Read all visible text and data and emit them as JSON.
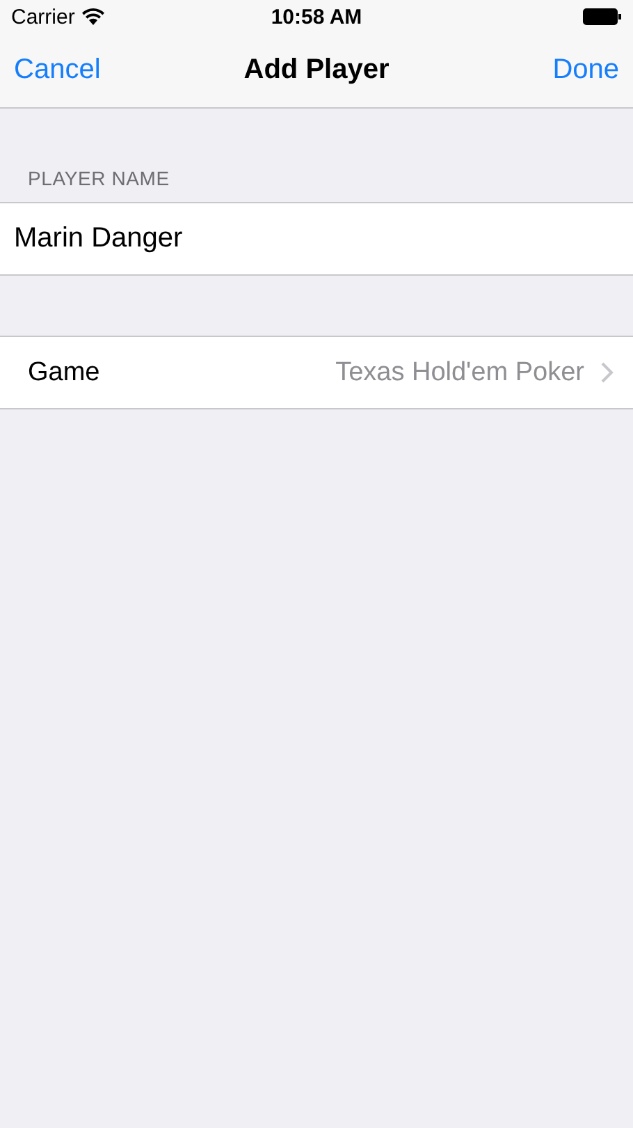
{
  "status_bar": {
    "carrier": "Carrier",
    "time": "10:58 AM"
  },
  "nav_bar": {
    "left_button": "Cancel",
    "title": "Add Player",
    "right_button": "Done"
  },
  "name_section": {
    "header": "PLAYER NAME",
    "value": "Marin Danger"
  },
  "game_row": {
    "label": "Game",
    "value": "Texas Hold'em Poker"
  }
}
